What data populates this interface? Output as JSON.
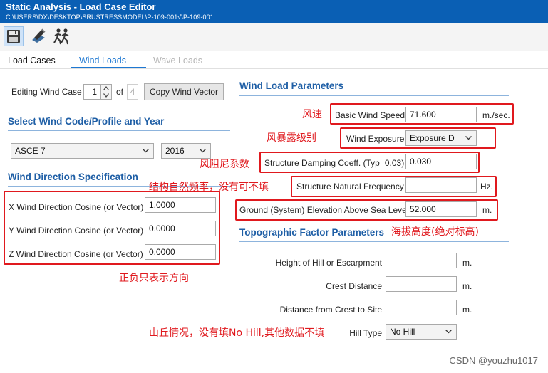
{
  "window": {
    "title": "Static Analysis - Load Case Editor",
    "path": "C:\\USERS\\DX\\DESKTOP\\SRUSTRESSMODEL\\P-109-001√\\P-109-001"
  },
  "toolbar": {
    "icons": [
      "save-icon",
      "edit-icon",
      "running-figures-icon"
    ]
  },
  "tabs": [
    {
      "label": "Load Cases",
      "state": "normal"
    },
    {
      "label": "Wind Loads",
      "state": "active"
    },
    {
      "label": "Wave Loads",
      "state": "disabled"
    }
  ],
  "left": {
    "editing_label": "Editing Wind Case",
    "case_number": "1",
    "of_label": "of",
    "case_total": "4",
    "copy_button": "Copy Wind Vector",
    "code_section": "Select Wind Code/Profile and Year",
    "code_value": "ASCE 7",
    "year_value": "2016",
    "direction_section": "Wind Direction Specification",
    "x_label": "X Wind Direction Cosine (or Vector)",
    "x_value": "1.0000",
    "y_label": "Y Wind Direction Cosine (or Vector)",
    "y_value": "0.0000",
    "z_label": "Z Wind Direction Cosine (or Vector)",
    "z_value": "0.0000"
  },
  "right": {
    "params_section": "Wind Load Parameters",
    "speed_label": "Basic Wind Speed",
    "speed_value": "71.600",
    "speed_unit": "m./sec.",
    "exposure_label": "Wind Exposure",
    "exposure_value": "Exposure D",
    "damping_label": "Structure Damping Coeff. (Typ=0.03)",
    "damping_value": "0.030",
    "frequency_label": "Structure Natural Frequency",
    "frequency_value": "",
    "frequency_unit": "Hz.",
    "elevation_label": "Ground (System) Elevation Above Sea Level",
    "elevation_value": "52.000",
    "elevation_unit": "m.",
    "topo_section": "Topographic Factor Parameters",
    "hill_height_label": "Height of Hill or Escarpment",
    "hill_height_unit": "m.",
    "crest_label": "Crest Distance",
    "crest_unit": "m.",
    "crest_site_label": "Distance from Crest to Site",
    "crest_site_unit": "m.",
    "hill_type_label": "Hill Type",
    "hill_type_value": "No Hill"
  },
  "annotations": {
    "wind_speed": "风速",
    "exposure": "风暴露级别",
    "damping": "风阻尼系数",
    "frequency": "结构自然频率，没有可不填",
    "elevation": "海拔高度(绝对标高)",
    "direction": "正负只表示方向",
    "hill": "山丘情况，没有填No Hill,其他数据不填"
  },
  "watermark": "CSDN @youzhu1017",
  "colors": {
    "titlebar": "#0a5fb4",
    "accent": "#1f5fa6",
    "annotation": "#e0191e"
  }
}
